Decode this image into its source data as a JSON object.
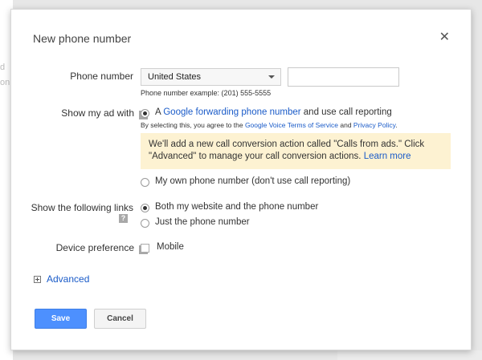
{
  "background": {
    "fragment_1": "d",
    "fragment_2": "on"
  },
  "dialog": {
    "title": "New phone number",
    "close_glyph": "✕"
  },
  "phone_number": {
    "label": "Phone number",
    "country_selected": "United States",
    "number_value": "",
    "example": "Phone number example: (201) 555-5555"
  },
  "show_ad_with": {
    "label": "Show my ad with",
    "help_glyph": "?",
    "option_forwarding": {
      "prefix": "A ",
      "link": "Google forwarding phone number",
      "suffix": " and use call reporting",
      "selected": true
    },
    "agreement": {
      "prefix": "By selecting this, you agree to the ",
      "link1": "Google Voice Terms of Service",
      "middle": " and ",
      "link2": "Privacy Policy",
      "suffix": "."
    },
    "notice": {
      "text": "We'll add a new call conversion action called \"Calls from ads.\" Click \"Advanced\" to manage your call conversion actions. ",
      "link": "Learn more"
    },
    "option_own": {
      "label": "My own phone number (don't use call reporting)",
      "selected": false
    }
  },
  "links": {
    "label": "Show the following links",
    "help_glyph": "?",
    "option_both": {
      "label": "Both my website and the phone number",
      "selected": true
    },
    "option_phone": {
      "label": "Just the phone number",
      "selected": false
    }
  },
  "device": {
    "label": "Device preference",
    "help_glyph": "?",
    "mobile_label": "Mobile",
    "mobile_checked": false
  },
  "advanced": {
    "label": "Advanced"
  },
  "buttons": {
    "save": "Save",
    "cancel": "Cancel"
  },
  "colors": {
    "link": "#1a5bc8",
    "primary_button": "#4d90fe",
    "notice_bg": "#fdf2d2"
  }
}
